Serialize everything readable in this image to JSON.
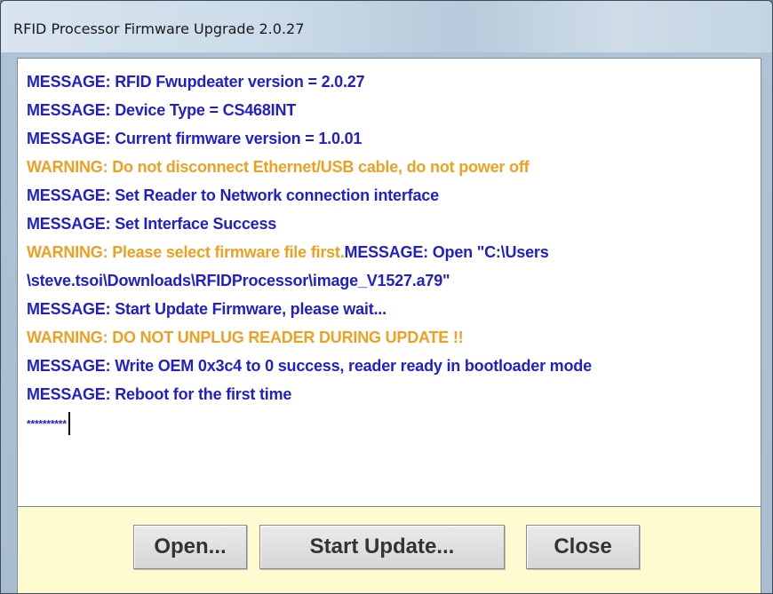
{
  "window": {
    "title": "RFID Processor Firmware Upgrade 2.0.27"
  },
  "log": {
    "lines": [
      {
        "type": "message",
        "text": "MESSAGE: RFID Fwupdeater version = 2.0.27"
      },
      {
        "type": "message",
        "text": "MESSAGE: Device Type = CS468INT"
      },
      {
        "type": "message",
        "text": "MESSAGE: Current firmware version = 1.0.01"
      },
      {
        "type": "warning",
        "text": "WARNING: Do not disconnect Ethernet/USB cable, do not power off"
      },
      {
        "type": "message",
        "text": "MESSAGE: Set Reader to Network connection interface"
      },
      {
        "type": "message",
        "text": "MESSAGE: Set Interface Success"
      },
      {
        "type": "mixed",
        "warning": "WARNING: Please select firmware file first.",
        "message": "MESSAGE: Open \"C:\\Users"
      },
      {
        "type": "message",
        "text": "\\steve.tsoi\\Downloads\\RFIDProcessor\\image_V1527.a79\""
      },
      {
        "type": "message",
        "text": "MESSAGE: Start Update Firmware, please wait..."
      },
      {
        "type": "warning",
        "text": "WARNING: DO NOT UNPLUG READER DURING UPDATE !!"
      },
      {
        "type": "message",
        "text": "MESSAGE: Write OEM 0x3c4 to 0 success, reader ready in bootloader mode"
      },
      {
        "type": "message",
        "text": "MESSAGE: Reboot for the first time"
      },
      {
        "type": "progress",
        "text": "**********"
      }
    ]
  },
  "buttons": {
    "open_label": "Open...",
    "start_update_label": "Start Update...",
    "close_label": "Close"
  },
  "colors": {
    "message": "#1f1fcf",
    "warning": "#f0a020",
    "button_panel": "#fffbd0"
  }
}
